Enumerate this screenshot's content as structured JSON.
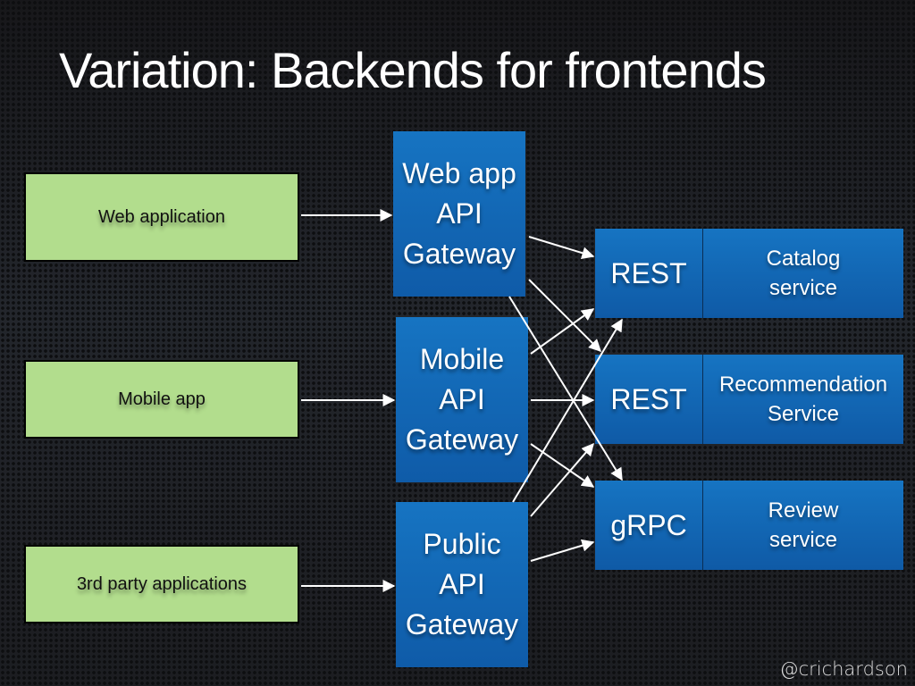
{
  "title": "Variation: Backends for frontends",
  "clients": [
    {
      "label": "Web application"
    },
    {
      "label": "Mobile app"
    },
    {
      "label": "3rd party applications"
    }
  ],
  "gateways": [
    {
      "lines": [
        "Web app",
        "API",
        "Gateway"
      ]
    },
    {
      "lines": [
        "Mobile",
        "API",
        "Gateway"
      ]
    },
    {
      "lines": [
        "Public",
        "API",
        "Gateway"
      ]
    }
  ],
  "services": [
    {
      "protocol": "REST",
      "name_lines": [
        "Catalog",
        "service"
      ]
    },
    {
      "protocol": "REST",
      "name_lines": [
        "Recommendation",
        "Service"
      ]
    },
    {
      "protocol": "gRPC",
      "name_lines": [
        "Review",
        "service"
      ]
    }
  ],
  "connections": [
    {
      "from": "client-0",
      "to": "gateway-0"
    },
    {
      "from": "client-1",
      "to": "gateway-1"
    },
    {
      "from": "client-2",
      "to": "gateway-2"
    },
    {
      "from": "gateway-0",
      "to": "service-0"
    },
    {
      "from": "gateway-0",
      "to": "service-1"
    },
    {
      "from": "gateway-0",
      "to": "service-2"
    },
    {
      "from": "gateway-1",
      "to": "service-0"
    },
    {
      "from": "gateway-1",
      "to": "service-1"
    },
    {
      "from": "gateway-1",
      "to": "service-2"
    },
    {
      "from": "gateway-2",
      "to": "service-0"
    },
    {
      "from": "gateway-2",
      "to": "service-1"
    },
    {
      "from": "gateway-2",
      "to": "service-2"
    }
  ],
  "colors": {
    "client_fill": "#b2dd8d",
    "box_blue": "#1568b6",
    "arrow": "#ffffff"
  },
  "credit": "@crichardson"
}
